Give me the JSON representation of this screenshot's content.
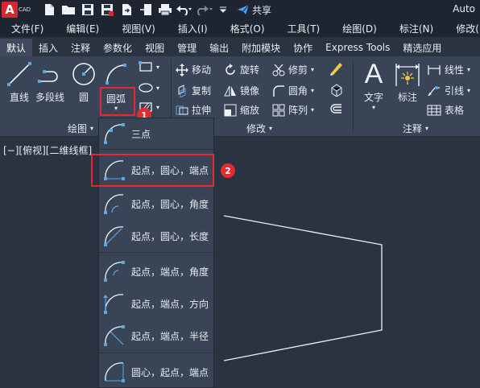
{
  "app": {
    "logo_letter": "A",
    "logo_sub": "CAD",
    "share_label": "共享",
    "title_right": "Auto"
  },
  "menu": [
    "文件(F)",
    "编辑(E)",
    "视图(V)",
    "插入(I)",
    "格式(O)",
    "工具(T)",
    "绘图(D)",
    "标注(N)",
    "修改(M)"
  ],
  "tabs": [
    "默认",
    "插入",
    "注释",
    "参数化",
    "视图",
    "管理",
    "输出",
    "附加模块",
    "协作",
    "Express Tools",
    "精选应用"
  ],
  "active_tab": "默认",
  "draw_panel": {
    "line": "直线",
    "polyline": "多段线",
    "circle": "圆",
    "arc": "圆弧",
    "label": "绘图"
  },
  "modify_panel": {
    "move": "移动",
    "rotate": "旋转",
    "trim": "修剪",
    "copy": "复制",
    "mirror": "镜像",
    "fillet": "圆角",
    "stretch": "拉伸",
    "scale": "缩放",
    "array": "阵列",
    "label": "修改"
  },
  "annotation_panel": {
    "text": "文字",
    "dimension": "标注",
    "linear": "线性",
    "leader": "引线",
    "table": "表格",
    "label": "注释"
  },
  "view_label": "[−][俯视][二维线框]",
  "arc_menu": [
    "三点",
    "起点，圆心，端点",
    "起点，圆心，角度",
    "起点，圆心，长度",
    "起点，端点，角度",
    "起点，端点，方向",
    "起点，端点，半径",
    "圆心，起点，端点"
  ],
  "badges": [
    "1",
    "2"
  ],
  "colors": {
    "accent_red": "#e4292f",
    "icon_blue": "#5aa7e6",
    "line_white": "#f0f0f0"
  }
}
